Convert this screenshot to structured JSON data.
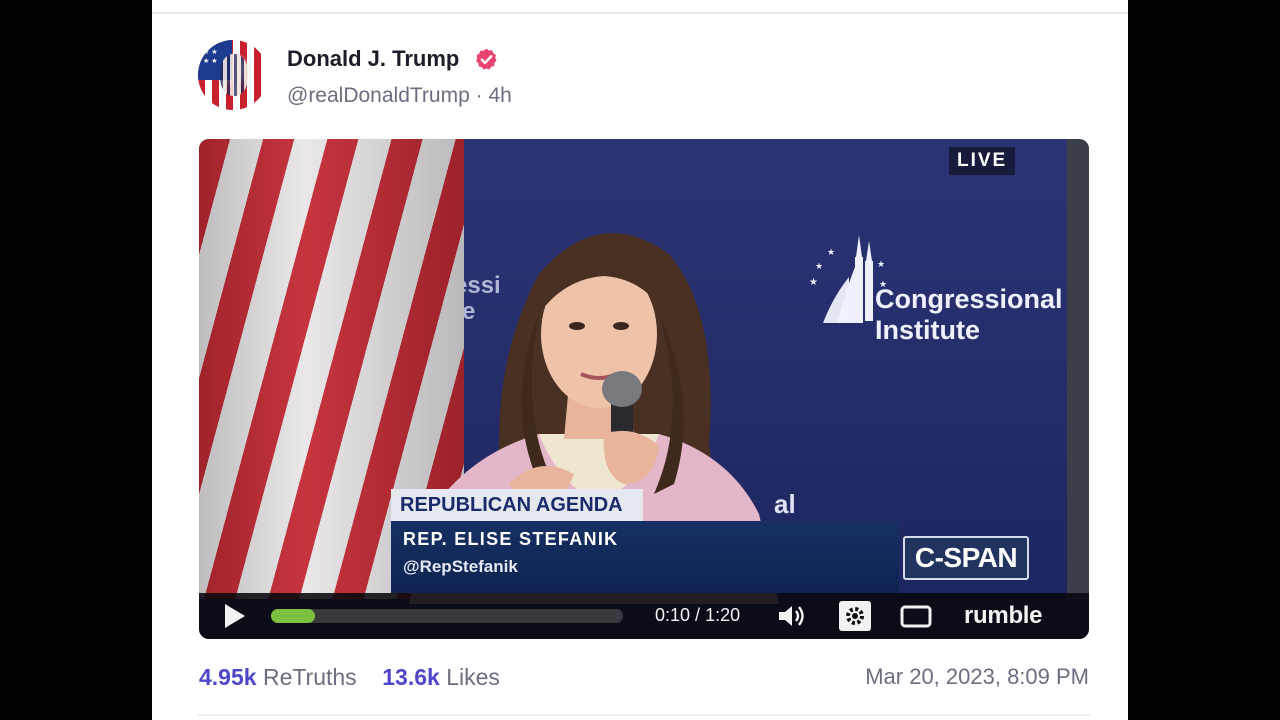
{
  "post": {
    "author_name": "Donald J. Trump",
    "handle": "@realDonaldTrump",
    "separator": "·",
    "age": "4h",
    "verified_color": "#e9446f",
    "timestamp": "Mar 20, 2023, 8:09 PM"
  },
  "stats": {
    "retruths_count": "4.95k",
    "retruths_label": "ReTruths",
    "likes_count": "13.6k",
    "likes_label": "Likes",
    "accent_color": "#4f47c9"
  },
  "video": {
    "live_badge": "LIVE",
    "backdrop_fragment": "essi\nte",
    "backdrop_fragment_lower": "al",
    "org_line1": "Congressional",
    "org_line2": "Institute",
    "lower_third": {
      "topic": "REPUBLICAN AGENDA",
      "name": "REP. ELISE STEFANIK",
      "handle": "@RepStefanik"
    },
    "network_logo": "C-SPAN",
    "player": {
      "current_time": "0:10",
      "time_separator": " / ",
      "duration": "1:20",
      "progress_fraction": 0.125,
      "brand": "rumble",
      "progress_color": "#7cc13f",
      "icons": [
        "play-icon",
        "volume-icon",
        "settings-icon",
        "fullscreen-icon"
      ]
    }
  }
}
